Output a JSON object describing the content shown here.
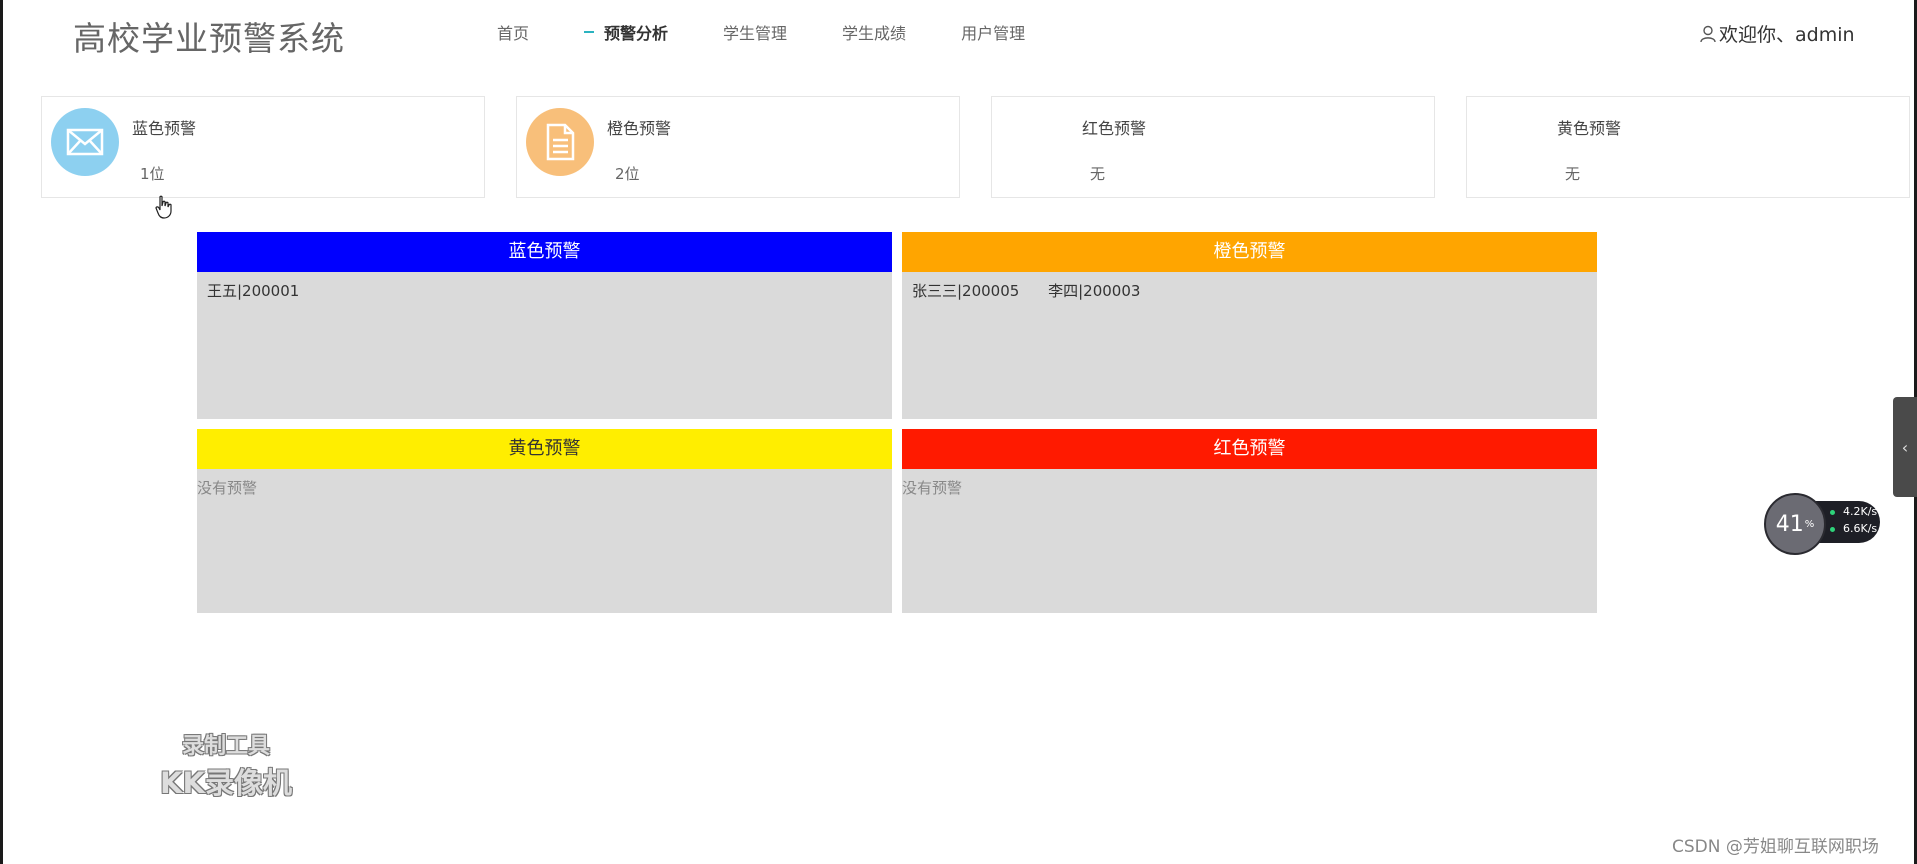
{
  "header": {
    "app_title": "高校学业预警系统",
    "nav": [
      {
        "label": "首页",
        "active": false
      },
      {
        "label": "预警分析",
        "active": true
      },
      {
        "label": "学生管理",
        "active": false
      },
      {
        "label": "学生成绩",
        "active": false
      },
      {
        "label": "用户管理",
        "active": false
      }
    ],
    "welcome": "欢迎你、admin"
  },
  "stats": [
    {
      "label": "蓝色预警",
      "value": "1位",
      "icon": "mail-icon",
      "color": "#8dd0f0"
    },
    {
      "label": "橙色预警",
      "value": "2位",
      "icon": "document-icon",
      "color": "#f8bf7a"
    },
    {
      "label": "红色预警",
      "value": "无"
    },
    {
      "label": "黄色预警",
      "value": "无"
    }
  ],
  "panels": {
    "blue": {
      "title": "蓝色预警",
      "color": "#0000ff",
      "text_color": "#ffffff",
      "entries": [
        "王五|200001"
      ]
    },
    "orange": {
      "title": "橙色预警",
      "color": "#ffa500",
      "text_color": "#ffffff",
      "entries": [
        "张三三|200005",
        "李四|200003"
      ]
    },
    "yellow": {
      "title": "黄色预警",
      "color": "#ffee00",
      "text_color": "#333333",
      "empty_text": "没有预警"
    },
    "red": {
      "title": "红色预警",
      "color": "#ff1a00",
      "text_color": "#ffffff",
      "empty_text": "没有预警"
    }
  },
  "overlays": {
    "recorder_line1": "录制工具",
    "recorder_line2": "KK录像机",
    "csdn": "CSDN @芳姐聊互联网职场",
    "speed_percent": "41",
    "speed_unit": "%",
    "upload": "4.2K/s",
    "download": "6.6K/s",
    "side_tab_icon": "chevron-left-icon"
  }
}
